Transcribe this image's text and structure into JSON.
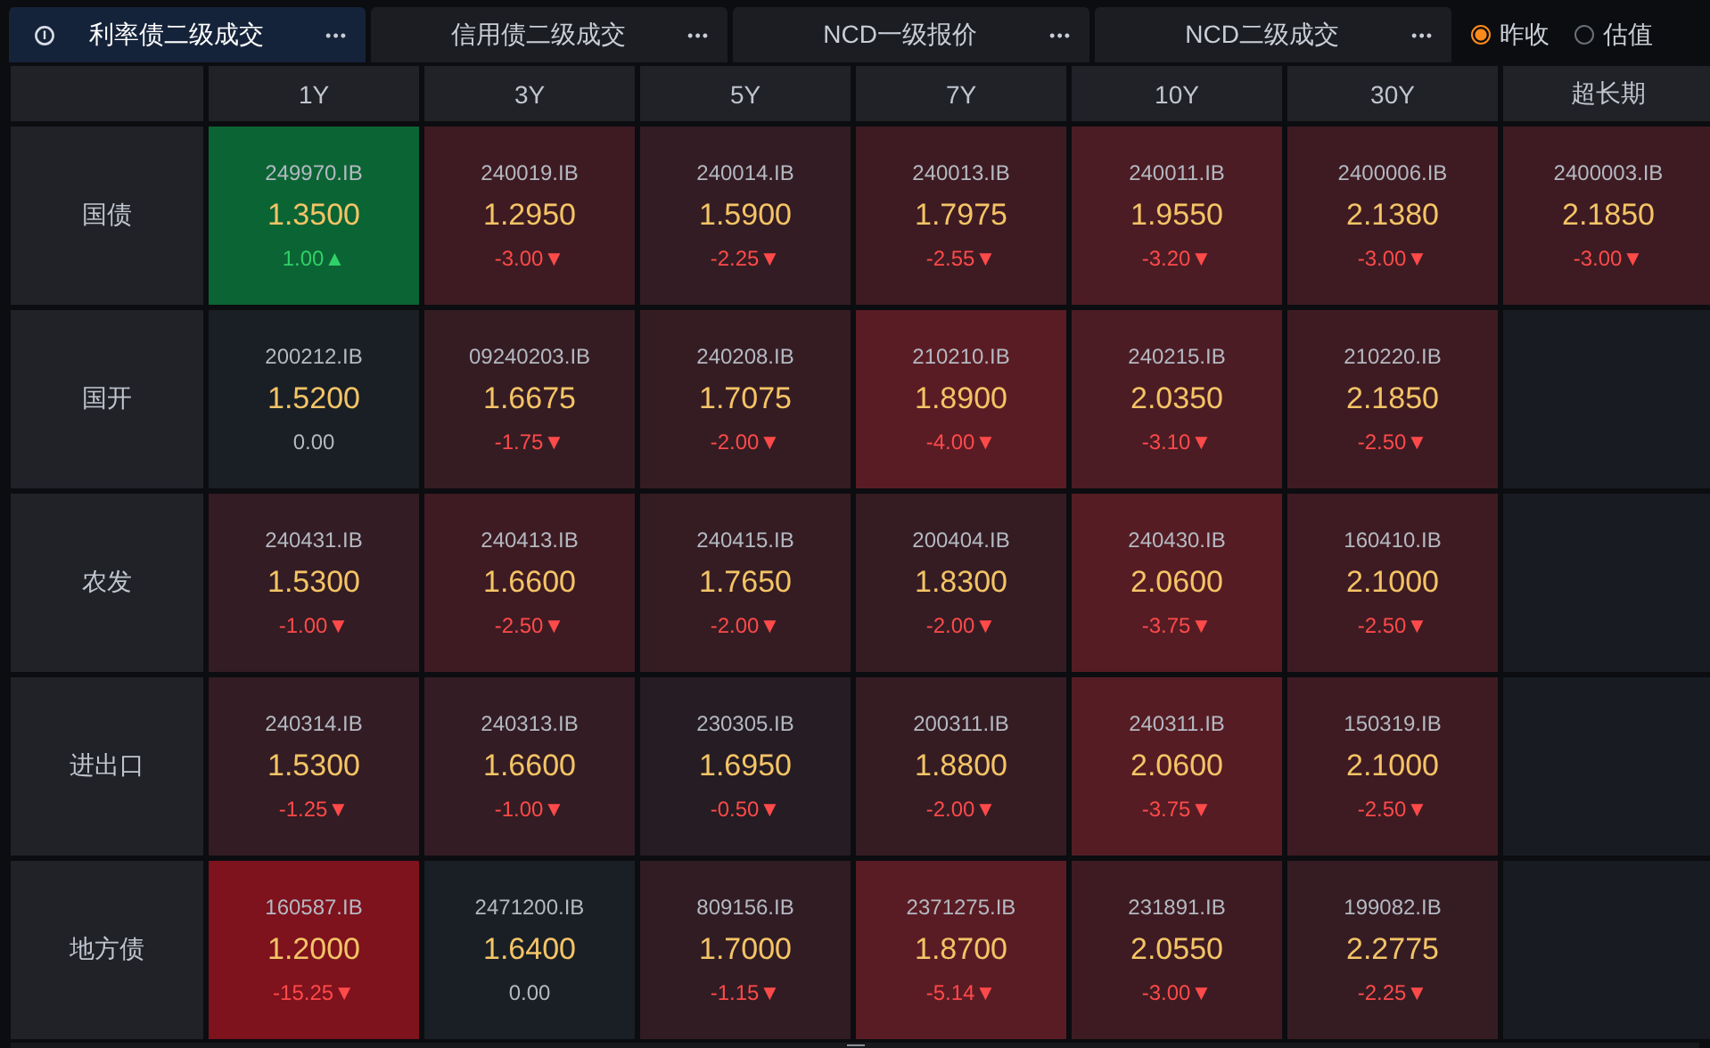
{
  "tabs": [
    {
      "label": "利率债二级成交",
      "selected": true
    },
    {
      "label": "信用债二级成交",
      "selected": false
    },
    {
      "label": "NCD一级报价",
      "selected": false
    },
    {
      "label": "NCD二级成交",
      "selected": false
    }
  ],
  "more_label": "•••",
  "price_basis": [
    {
      "label": "昨收",
      "selected": true
    },
    {
      "label": "估值",
      "selected": false
    }
  ],
  "table": {
    "columns": [
      "1Y",
      "3Y",
      "5Y",
      "7Y",
      "10Y",
      "30Y",
      "超长期"
    ],
    "rows": [
      {
        "label": "国债",
        "cells": [
          {
            "code": "249970.IB",
            "value": "1.3500",
            "change": "1.00▲",
            "kind": "up",
            "color": "#0b6434"
          },
          {
            "code": "240019.IB",
            "value": "1.2950",
            "change": "-3.00▼",
            "kind": "down",
            "color": "#3e1b22"
          },
          {
            "code": "240014.IB",
            "value": "1.5900",
            "change": "-2.25▼",
            "kind": "down",
            "color": "#331c23"
          },
          {
            "code": "240013.IB",
            "value": "1.7975",
            "change": "-2.55▼",
            "kind": "down",
            "color": "#3e1b22"
          },
          {
            "code": "240011.IB",
            "value": "1.9550",
            "change": "-3.20▼",
            "kind": "down",
            "color": "#4b1c24"
          },
          {
            "code": "2400006.IB",
            "value": "2.1380",
            "change": "-3.00▼",
            "kind": "down",
            "color": "#3e1b22"
          },
          {
            "code": "2400003.IB",
            "value": "2.1850",
            "change": "-3.00▼",
            "kind": "down",
            "color": "#3e1b22"
          }
        ]
      },
      {
        "label": "国开",
        "cells": [
          {
            "code": "200212.IB",
            "value": "1.5200",
            "change": "0.00",
            "kind": "flat",
            "color": "#1a1f26"
          },
          {
            "code": "09240203.IB",
            "value": "1.6675",
            "change": "-1.75▼",
            "kind": "down",
            "color": "#351c23"
          },
          {
            "code": "240208.IB",
            "value": "1.7075",
            "change": "-2.00▼",
            "kind": "down",
            "color": "#351c23"
          },
          {
            "code": "210210.IB",
            "value": "1.8900",
            "change": "-4.00▼",
            "kind": "down",
            "color": "#5a1c24"
          },
          {
            "code": "240215.IB",
            "value": "2.0350",
            "change": "-3.10▼",
            "kind": "down",
            "color": "#4b1c24"
          },
          {
            "code": "210220.IB",
            "value": "2.1850",
            "change": "-2.50▼",
            "kind": "down",
            "color": "#3e1b22"
          },
          null
        ]
      },
      {
        "label": "农发",
        "cells": [
          {
            "code": "240431.IB",
            "value": "1.5300",
            "change": "-1.00▼",
            "kind": "down",
            "color": "#331c23"
          },
          {
            "code": "240413.IB",
            "value": "1.6600",
            "change": "-2.50▼",
            "kind": "down",
            "color": "#3e1b22"
          },
          {
            "code": "240415.IB",
            "value": "1.7650",
            "change": "-2.00▼",
            "kind": "down",
            "color": "#351c23"
          },
          {
            "code": "200404.IB",
            "value": "1.8300",
            "change": "-2.00▼",
            "kind": "down",
            "color": "#351c23"
          },
          {
            "code": "240430.IB",
            "value": "2.0600",
            "change": "-3.75▼",
            "kind": "down",
            "color": "#551c24"
          },
          {
            "code": "160410.IB",
            "value": "2.1000",
            "change": "-2.50▼",
            "kind": "down",
            "color": "#3e1b22"
          },
          null
        ]
      },
      {
        "label": "进出口",
        "cells": [
          {
            "code": "240314.IB",
            "value": "1.5300",
            "change": "-1.25▼",
            "kind": "down",
            "color": "#331c23"
          },
          {
            "code": "240313.IB",
            "value": "1.6600",
            "change": "-1.00▼",
            "kind": "down",
            "color": "#331c23"
          },
          {
            "code": "230305.IB",
            "value": "1.6950",
            "change": "-0.50▼",
            "kind": "down",
            "color": "#261c23"
          },
          {
            "code": "200311.IB",
            "value": "1.8800",
            "change": "-2.00▼",
            "kind": "down",
            "color": "#351c23"
          },
          {
            "code": "240311.IB",
            "value": "2.0600",
            "change": "-3.75▼",
            "kind": "down",
            "color": "#551c24"
          },
          {
            "code": "150319.IB",
            "value": "2.1000",
            "change": "-2.50▼",
            "kind": "down",
            "color": "#3e1b22"
          },
          null
        ]
      },
      {
        "label": "地方债",
        "cells": [
          {
            "code": "160587.IB",
            "value": "1.2000",
            "change": "-15.25▼",
            "kind": "down",
            "color": "#7e121d"
          },
          {
            "code": "2471200.IB",
            "value": "1.6400",
            "change": "0.00",
            "kind": "flat",
            "color": "#1a1f26"
          },
          {
            "code": "809156.IB",
            "value": "1.7000",
            "change": "-1.15▼",
            "kind": "down",
            "color": "#311c23"
          },
          {
            "code": "2371275.IB",
            "value": "1.8700",
            "change": "-5.14▼",
            "kind": "down",
            "color": "#5a1c24"
          },
          {
            "code": "231891.IB",
            "value": "2.0550",
            "change": "-3.00▼",
            "kind": "down",
            "color": "#3e1b22"
          },
          {
            "code": "199082.IB",
            "value": "2.2775",
            "change": "-2.25▼",
            "kind": "down",
            "color": "#351c23"
          },
          null
        ]
      }
    ]
  }
}
